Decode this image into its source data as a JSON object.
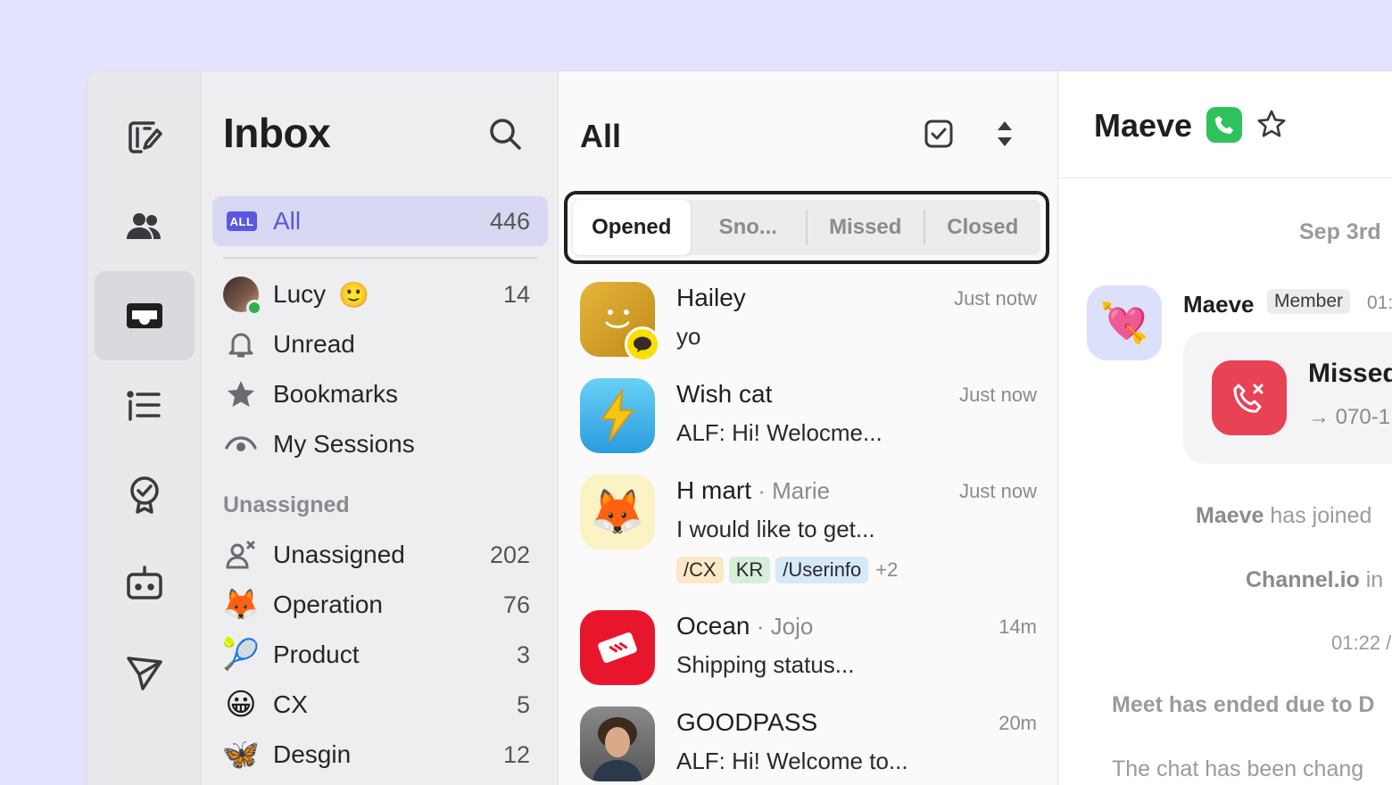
{
  "sidebar": {
    "title": "Inbox",
    "all": {
      "badge": "ALL",
      "label": "All",
      "count": "446"
    },
    "personal": [
      {
        "label": "Lucy",
        "emoji": "🙂",
        "count": "14"
      },
      {
        "label": "Unread",
        "count": ""
      },
      {
        "label": "Bookmarks",
        "count": ""
      },
      {
        "label": "My Sessions",
        "count": ""
      }
    ],
    "section_label": "Unassigned",
    "groups": [
      {
        "label": "Unassigned",
        "count": "202",
        "icon": "🦊"
      },
      {
        "label": "Operation",
        "count": "76",
        "icon": "🦊"
      },
      {
        "label": "Product",
        "count": "3",
        "icon": "🎾"
      },
      {
        "label": "CX",
        "count": "5",
        "icon": "😀"
      },
      {
        "label": "Desgin",
        "count": "12",
        "icon": "🦋"
      }
    ]
  },
  "list": {
    "title": "All",
    "tabs": [
      "Opened",
      "Sno...",
      "Missed",
      "Closed"
    ],
    "chats": [
      {
        "name": "Hailey",
        "sub": "",
        "time": "Just notw",
        "message": "yo"
      },
      {
        "name": "Wish cat",
        "sub": "",
        "time": "Just now",
        "message": "ALF: Hi! Welocme..."
      },
      {
        "name": "H mart",
        "sub": "Marie",
        "time": "Just now",
        "message": "I would like to get...",
        "tags": [
          "/CX",
          "KR",
          "/Userinfo"
        ],
        "more": "+2"
      },
      {
        "name": "Ocean",
        "sub": "Jojo",
        "time": "14m",
        "message": "Shipping status..."
      },
      {
        "name": "GOODPASS",
        "sub": "",
        "time": "20m",
        "message": "ALF: Hi! Welcome to..."
      }
    ]
  },
  "detail": {
    "name": "Maeve",
    "date": "Sep 3rd",
    "sender": "Maeve",
    "role": "Member",
    "msg_time": "01:",
    "call_title": "Missed",
    "call_number": "070-1",
    "sys1_name": "Maeve",
    "sys1_text": " has joined",
    "sys2_name": "Channel.io",
    "sys2_text": " in",
    "sys3": "01:22 /",
    "sys4": "Meet has ended due to D",
    "sys5": "The chat has been chang"
  },
  "colors": {
    "accent": "#5a57e0",
    "online": "#2fb04e",
    "call_missed": "#e84255",
    "phone": "#2fc25c"
  }
}
